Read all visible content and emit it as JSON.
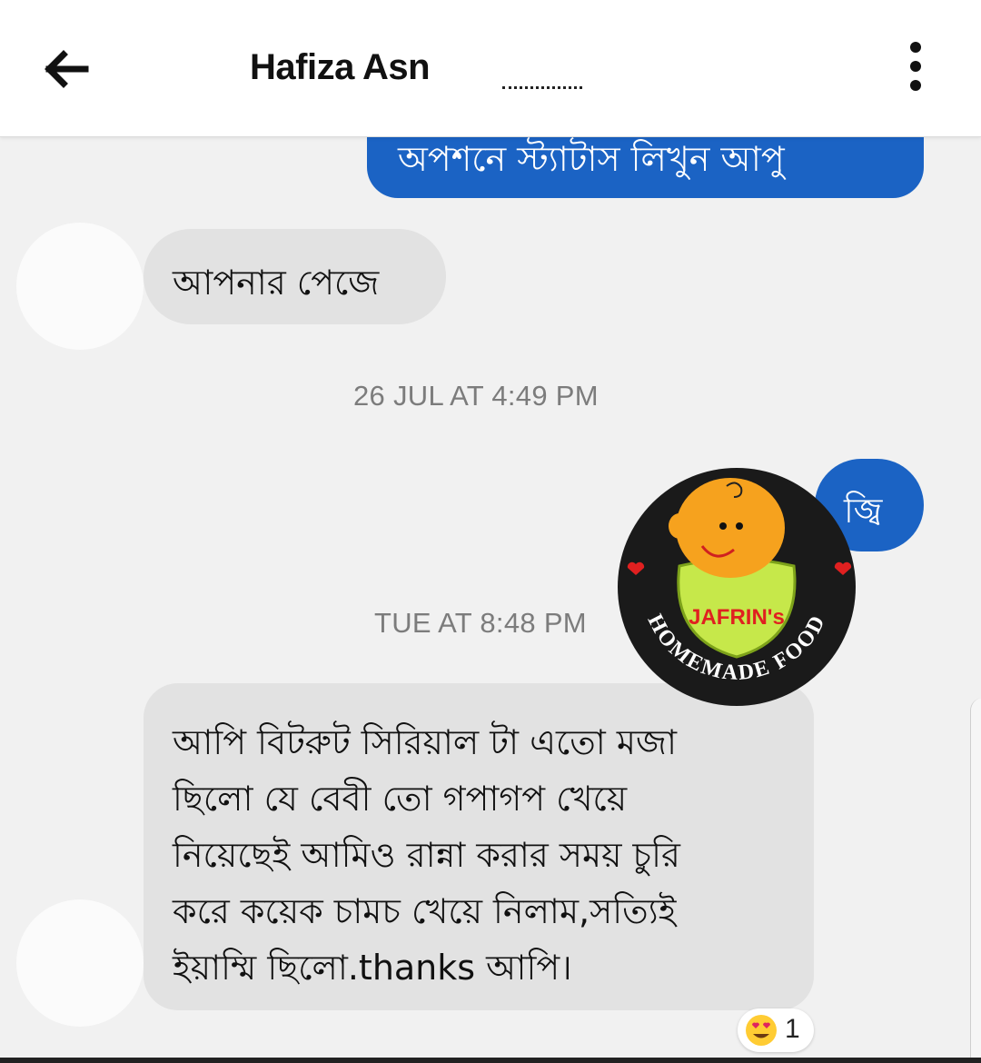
{
  "header": {
    "title": "Hafiza Asn",
    "title_suffix": "_....",
    "back_icon": "arrow-left-icon",
    "more_icon": "more-vertical-icon"
  },
  "messages": [
    {
      "direction": "outgoing",
      "text": "অপশনে স্ট্যাটাস লিখুন আপু"
    },
    {
      "direction": "incoming",
      "text": "আপনার পেজে"
    },
    {
      "type": "timestamp",
      "text": "26 JUL AT 4:49 PM"
    },
    {
      "direction": "outgoing",
      "text": "জ্বি"
    },
    {
      "type": "timestamp",
      "text": "TUE AT 8:48 PM"
    },
    {
      "direction": "incoming",
      "lines": [
        "আপি বিটরুট সিরিয়াল টা এতো মজা",
        "ছিলো যে বেবী তো গপাগপ খেয়ে",
        "নিয়েছেই আমিও রান্না করার সময় চুরি",
        "করে কয়েক চামচ খেয়ে নিলাম,সত্যিই",
        "ইয়াম্মি ছিলো.thanks আপি।"
      ]
    }
  ],
  "logo": {
    "name": "JAFRIN's",
    "tagline": "HOMEMADE FOOD"
  },
  "reaction": {
    "emoji": "heart-eyes-emoji-icon",
    "count": "1"
  },
  "colors": {
    "outgoing_bubble": "#1b63c4",
    "incoming_bubble": "#e2e2e2",
    "background": "#f1f1f1"
  }
}
